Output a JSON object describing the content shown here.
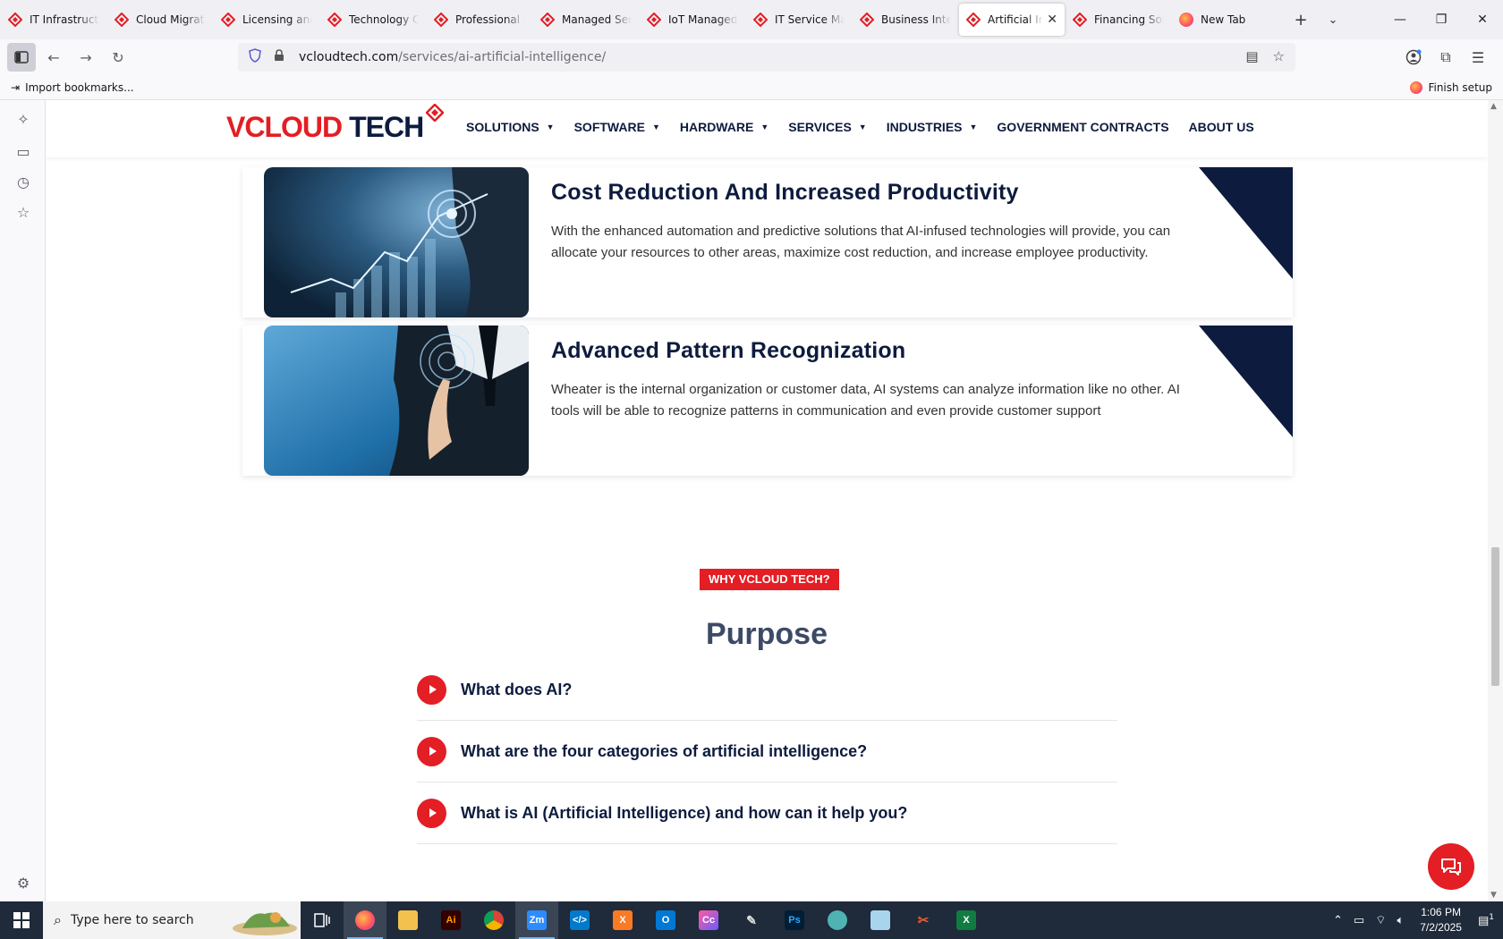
{
  "browser": {
    "tabs": [
      {
        "label": "IT Infrastructure",
        "active": false
      },
      {
        "label": "Cloud Migration",
        "active": false
      },
      {
        "label": "Licensing and",
        "active": false
      },
      {
        "label": "Technology Co",
        "active": false
      },
      {
        "label": "Professional Se",
        "active": false
      },
      {
        "label": "Managed Serv",
        "active": false
      },
      {
        "label": "IoT Managed S",
        "active": false
      },
      {
        "label": "IT Service Man",
        "active": false
      },
      {
        "label": "Business Intelli",
        "active": false
      },
      {
        "label": "Artificial Int",
        "active": true
      },
      {
        "label": "Financing Solu",
        "active": false
      },
      {
        "label": "New Tab",
        "active": false
      }
    ],
    "url_host": "vcloudtech.com",
    "url_path": "/services/ai-artificial-intelligence/",
    "bookmarks_import": "Import bookmarks...",
    "finish_setup": "Finish setup"
  },
  "site": {
    "logo_part1": "VCLOUD",
    "logo_part2": "TECH",
    "nav": [
      {
        "label": "SOLUTIONS",
        "dropdown": true
      },
      {
        "label": "SOFTWARE",
        "dropdown": true
      },
      {
        "label": "HARDWARE",
        "dropdown": true
      },
      {
        "label": "SERVICES",
        "dropdown": true
      },
      {
        "label": "INDUSTRIES",
        "dropdown": true
      },
      {
        "label": "GOVERNMENT CONTRACTS",
        "dropdown": false
      },
      {
        "label": "ABOUT US",
        "dropdown": false
      }
    ],
    "cards": [
      {
        "title": "Cost Reduction And Increased Productivity",
        "text": "With the enhanced automation and predictive solutions that AI-infused technologies will provide, you can allocate your resources to other areas, maximize cost reduction, and increase employee productivity."
      },
      {
        "title": "Advanced Pattern Recognization",
        "text": "Wheater is the internal organization or customer data, AI systems can analyze information like no other. AI tools will be able to recognize patterns in communication and even provide customer support"
      }
    ],
    "badge": "WHY VCLOUD TECH?",
    "section_title": "Purpose",
    "faqs": [
      "What does AI?",
      "What are the four categories of artificial intelligence?",
      "What is AI (Artificial Intelligence) and how can it help you?"
    ]
  },
  "colors": {
    "brand_red": "#e31e24",
    "brand_navy": "#0d1b3e"
  },
  "taskbar": {
    "search_placeholder": "Type here to search",
    "time": "1:06 PM",
    "date": "7/2/2025",
    "notification_count": "1"
  }
}
